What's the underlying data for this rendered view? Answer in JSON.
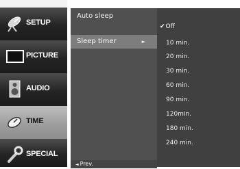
{
  "menu": {
    "categories": [
      {
        "label": "SETUP",
        "icon": "satellite-dish-icon"
      },
      {
        "label": "PICTURE",
        "icon": "screen-icon"
      },
      {
        "label": "AUDIO",
        "icon": "speaker-icon"
      },
      {
        "label": "TIME",
        "icon": "clock-icon"
      },
      {
        "label": "SPECIAL",
        "icon": "wrench-icon"
      }
    ],
    "active_category": "TIME"
  },
  "submenu": {
    "items": [
      {
        "label": "Auto sleep"
      },
      {
        "label": "Sleep timer",
        "arrow": "►"
      }
    ],
    "prev_label": "Prev.",
    "prev_arrow": "◄"
  },
  "options": {
    "check_mark": "✔",
    "items": [
      "Off",
      "10 min.",
      "20 min.",
      "30 min.",
      "60 min.",
      "90 min.",
      "120min.",
      "180 min.",
      "240 min."
    ],
    "checked": "Off"
  },
  "colors": {
    "nav_button": "#242424",
    "nav_active": "#9c9c9c",
    "submenu_bg": "#505050",
    "submenu_selected": "#7d7d7d",
    "options_bg": "#404040"
  }
}
